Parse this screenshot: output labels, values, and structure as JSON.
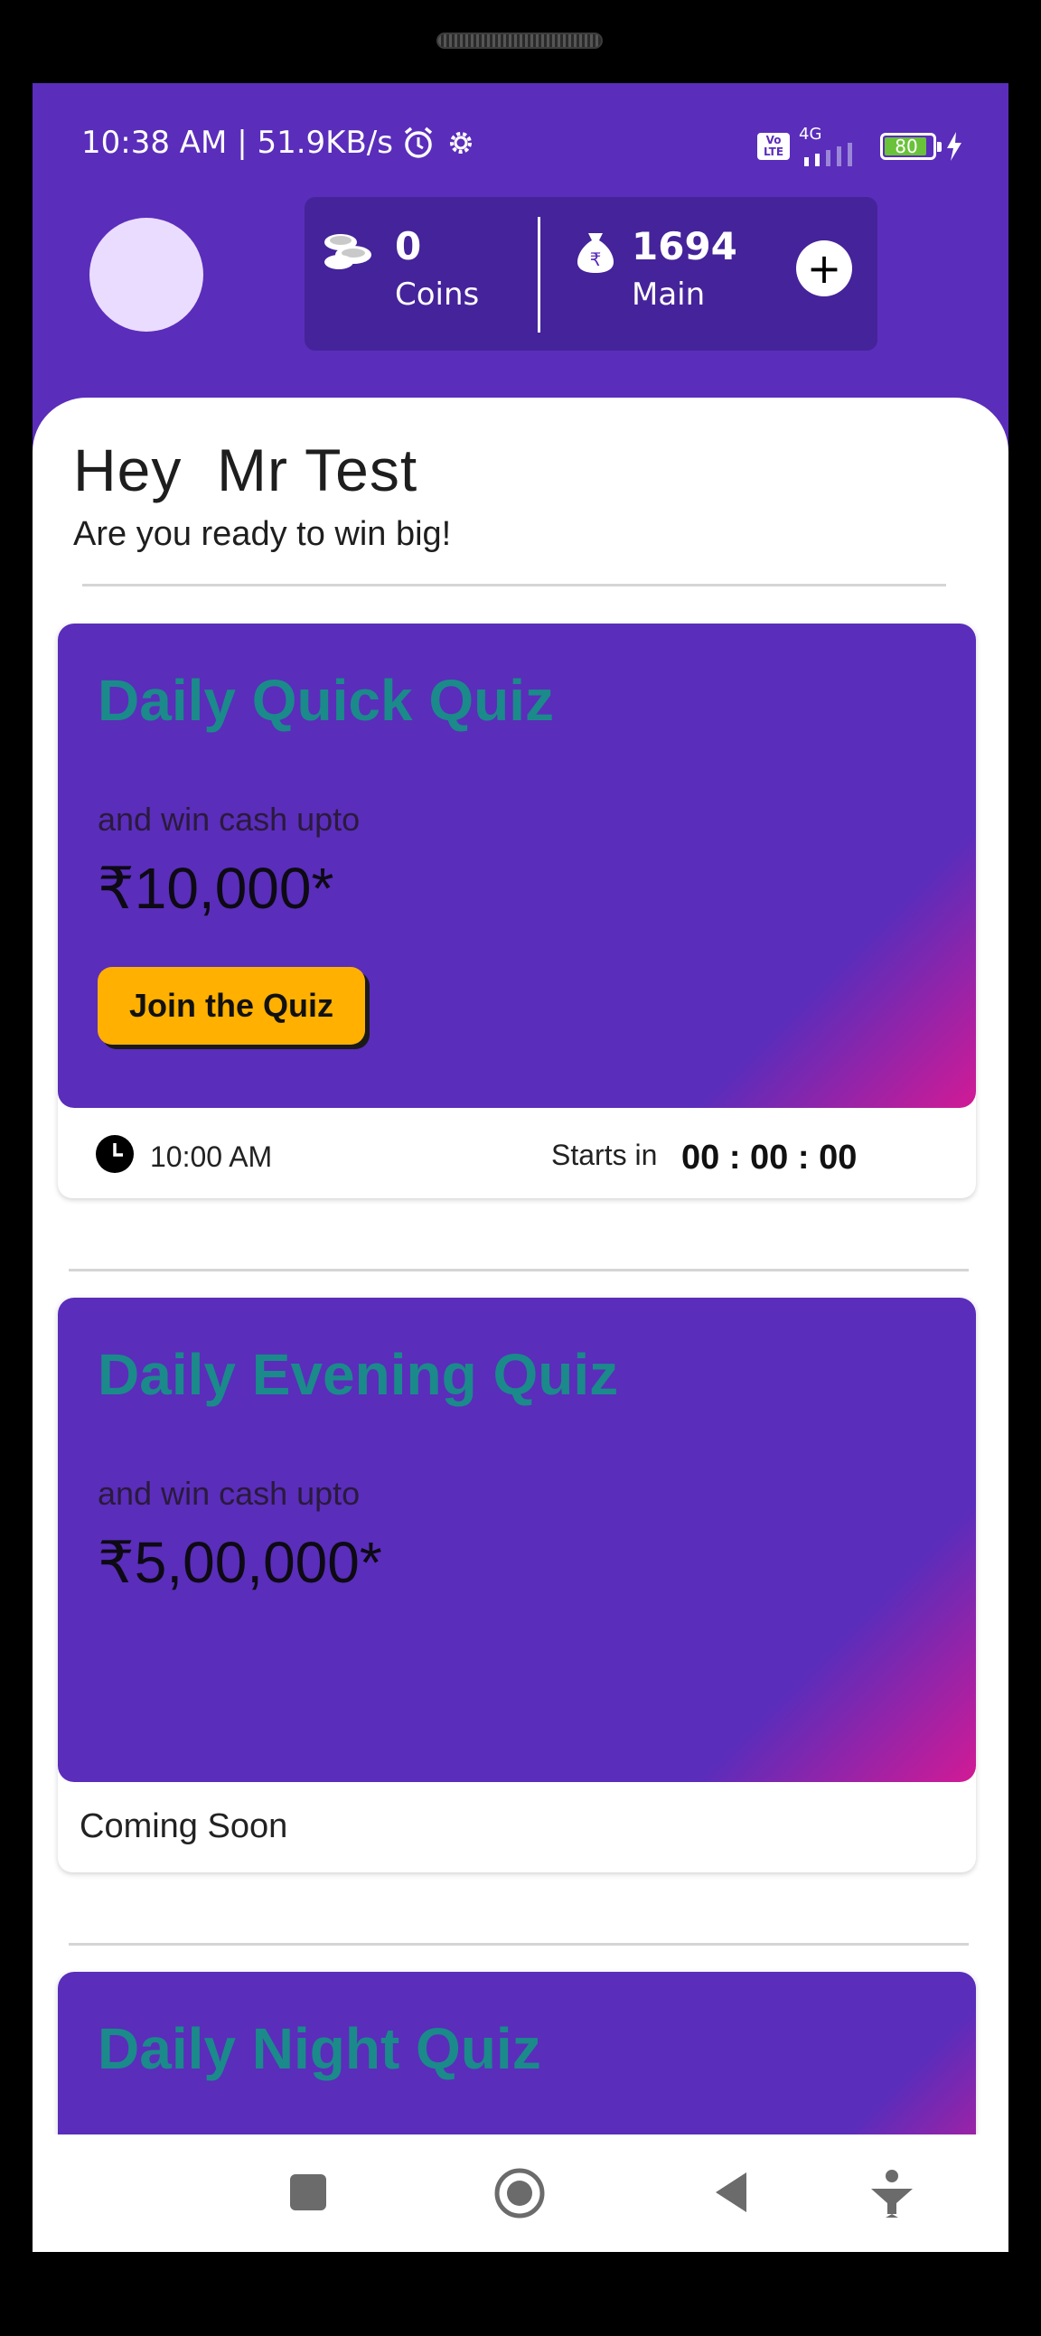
{
  "status_bar": {
    "time_speed": "10:38 AM | 51.9KB/s",
    "network": "4G",
    "volte": "Vo LTE",
    "battery": "80"
  },
  "wallet": {
    "coins_value": "0",
    "coins_label": "Coins",
    "main_value": "1694",
    "main_label": "Main"
  },
  "greeting": {
    "title": "Hey  Mr Test",
    "subtitle": "Are you ready to win big!"
  },
  "quizzes": [
    {
      "title": "Daily Quick Quiz",
      "subtitle": "and win cash upto",
      "amount": "₹10,000*",
      "button": "Join the Quiz",
      "time": "10:00 AM",
      "starts_label": "Starts in",
      "countdown": "00 : 00 : 00"
    },
    {
      "title": "Daily Evening Quiz",
      "subtitle": "and win cash upto",
      "amount": "₹5,00,000*",
      "status": "Coming Soon"
    },
    {
      "title": "Daily Night Quiz"
    }
  ],
  "colors": {
    "primary": "#5a2dbb",
    "title_teal": "#1b8a8a",
    "button_yellow": "#ffb000",
    "gradient_pink": "#d21a95"
  }
}
